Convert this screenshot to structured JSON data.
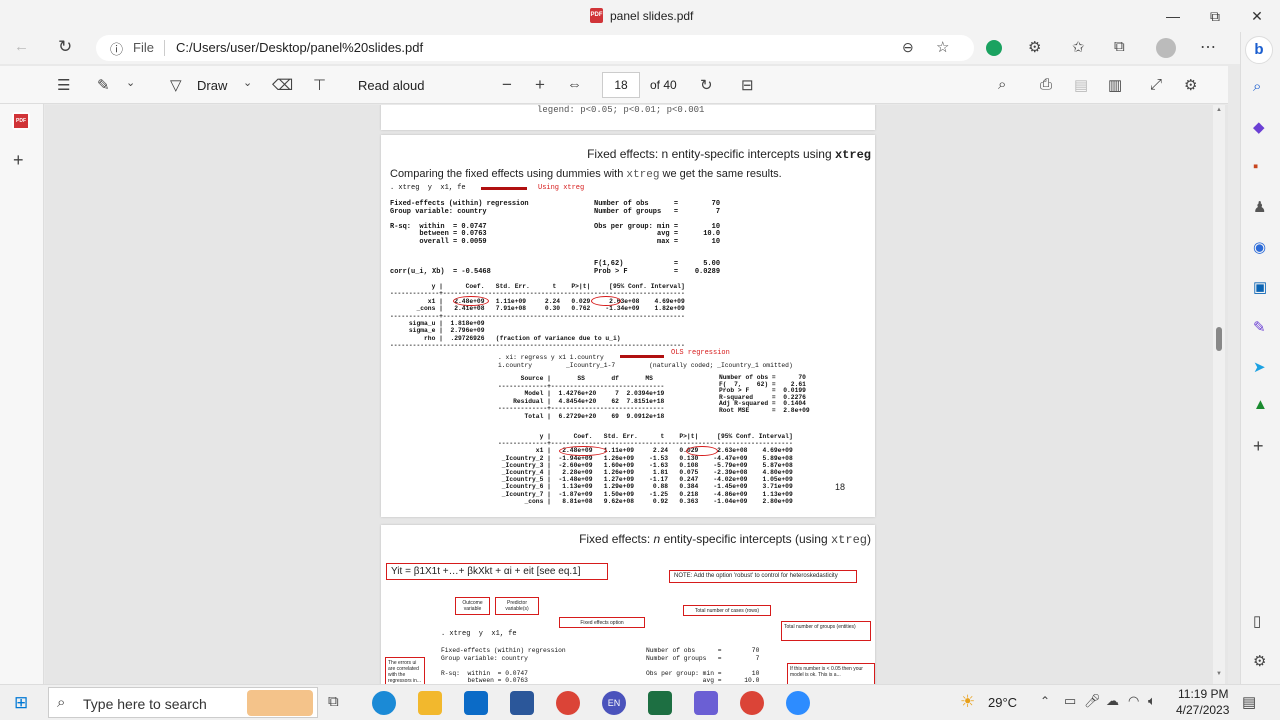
{
  "window": {
    "title": "panel slides.pdf",
    "min": "—",
    "max": "⧉",
    "close": "✕"
  },
  "addressbar": {
    "file_label": "File",
    "url": "C:/Users/user/Desktop/panel%20slides.pdf"
  },
  "pdf_toolbar": {
    "draw_label": "Draw",
    "read_aloud_label": "Read aloud",
    "page_current": "18",
    "page_total": "of 40"
  },
  "prev_page_cut": {
    "text": "legend:    p<0.05;     p<0.01;     p<0.001"
  },
  "slide18": {
    "title_pre": "Fixed effects: n entity-specific intercepts using ",
    "title_code": "xtreg",
    "subtitle_pre": "Comparing the fixed effects using dummies with ",
    "subtitle_code": "xtreg",
    "subtitle_post": " we get the same results.",
    "cmd": ". xtreg  y  x1, fe",
    "using_note": "Using xtreg",
    "hdr_left": "Fixed-effects (within) regression\nGroup variable: country\n\nR-sq:  within  = 0.0747\n       between = 0.0763\n       overall = 0.0059\n\n\n\ncorr(u_i, Xb)  = -0.5468",
    "hdr_right": "Number of obs      =        70\nNumber of groups   =         7\n\nObs per group: min =        10\n               avg =      10.0\n               max =        10\n\n\nF(1,62)            =      5.00\nProb > F           =    0.0289",
    "table1": "           y |      Coef.   Std. Err.      t    P>|t|     [95% Conf. Interval]\n-------------+----------------------------------------------------------------\n          x1 |   2.48e+09   1.11e+09     2.24   0.029     2.63e+08    4.69e+09\n       _cons |   2.41e+08   7.91e+08     0.30   0.762    -1.34e+09    1.82e+09\n-------------+----------------------------------------------------------------\n     sigma_u |  1.818e+09\n     sigma_e |  2.796e+09\n         rho |  .29726926   (fraction of variance due to u_i)\n------------------------------------------------------------------------------",
    "ols_cmd": ". xi: regress y x1 i.country\ni.country         _Icountry_1-7         (naturally coded; _Icountry_1 omitted)",
    "ols_note": "OLS regression",
    "anova": "      Source |       SS       df       MS\n-------------+------------------------------\n       Model |  1.4276e+20     7  2.0394e+19\n    Residual |  4.8454e+20    62  7.8151e+18\n-------------+------------------------------\n       Total |  6.2729e+20    69  9.0912e+18",
    "ols_stats": "Number of obs =      70\nF(  7,    62) =    2.61\nProb > F      =  0.0199\nR-squared     =  0.2276\nAdj R-squared =  0.1404\nRoot MSE      =  2.8e+09",
    "table2": "           y |      Coef.   Std. Err.      t    P>|t|     [95% Conf. Interval]\n-------------+----------------------------------------------------------------\n          x1 |   2.48e+09   1.11e+09     2.24   0.029     2.63e+08    4.69e+09\n _Icountry_2 |  -1.94e+09   1.26e+09    -1.53   0.130    -4.47e+09    5.89e+08\n _Icountry_3 |  -2.60e+09   1.60e+09    -1.63   0.108    -5.79e+09    5.87e+08\n _Icountry_4 |   2.28e+09   1.26e+09     1.81   0.075    -2.39e+08    4.80e+09\n _Icountry_5 |  -1.48e+09   1.27e+09    -1.17   0.247    -4.02e+09    1.05e+09\n _Icountry_6 |   1.13e+09   1.29e+09     0.88   0.384    -1.45e+09    3.71e+09\n _Icountry_7 |  -1.87e+09   1.50e+09    -1.25   0.218    -4.86e+09    1.13e+09\n       _cons |   8.81e+08   9.62e+08     0.92   0.363    -1.04e+09    2.80e+09",
    "page_number": "18"
  },
  "slide19": {
    "title_pre": "Fixed effects: ",
    "title_n": "n",
    "title_mid": " entity-specific intercepts (using ",
    "title_code": "xtreg",
    "title_post": ")",
    "equation": "Yit = β1X1t +…+ βkXkt + αi + eit     [see eq.1]",
    "note": "NOTE: Add the option 'robust' to control for heteroskedasticity",
    "outcome_label": "Outcome variable",
    "predictor_label": "Predictor variable(s)",
    "fe_option_label": "Fixed effects option",
    "total_cases_label": "Total number of cases (rows)",
    "total_groups_label": "Total number of groups (entities)",
    "cmd": ". xtreg  y  x1, fe",
    "errors_label": "The errors ui are correlated with the regressors in...",
    "prob_note": "If this number is < 0.05 then your model is ok. This is a...",
    "out_left": "Fixed-effects (within) regression\nGroup variable: country\n\nR-sq:  within  = 0.0747\n       between = 0.0763",
    "out_right": "Number of obs      =        70\nNumber of groups   =         7\n\nObs per group: min =        10\n               avg =      10.0"
  },
  "taskbar": {
    "search_placeholder": "Type here to search",
    "weather": "29°C",
    "time": "11:19 PM",
    "date": "4/27/2023",
    "lang": "EN"
  }
}
